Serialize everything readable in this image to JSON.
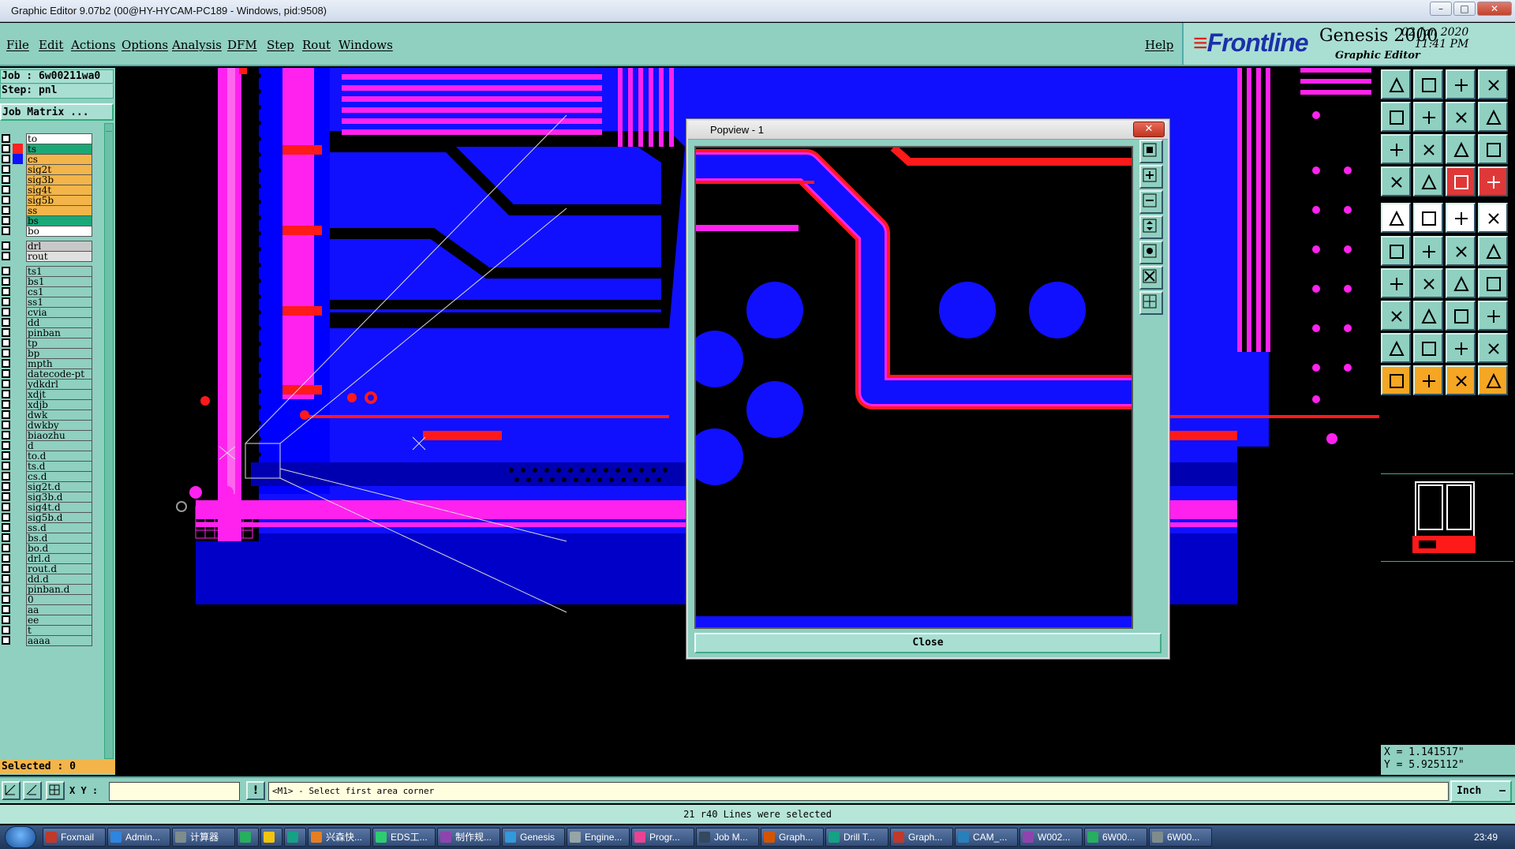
{
  "window": {
    "title": "Graphic Editor 9.07b2 (00@HY-HYCAM-PC189 - Windows, pid:9508)",
    "controls": [
      "–",
      "□",
      "✕"
    ]
  },
  "menu": {
    "items": [
      "File",
      "Edit",
      "Actions",
      "Options",
      "Analysis",
      "DFM",
      "Step",
      "Rout",
      "Windows"
    ],
    "help": "Help"
  },
  "brand": {
    "logo": "Frontline",
    "product": "Genesis 2000",
    "subtitle": "Graphic Editor",
    "date": "02 Jan 2020",
    "time": "11:41 PM"
  },
  "left_panel": {
    "job": "Job : 6w00211wa0",
    "step": "Step: pnl",
    "job_matrix": "Job Matrix ...",
    "selected": "Selected : 0"
  },
  "layers": [
    {
      "name": "to",
      "color": "#ffffff",
      "swatch": ""
    },
    {
      "name": "ts",
      "color": "#1aa877",
      "swatch": "#ff2020",
      "active": true
    },
    {
      "name": "cs",
      "color": "#f3b54a",
      "swatch": "#1010ff"
    },
    {
      "name": "sig2t",
      "color": "#f3b54a",
      "swatch": ""
    },
    {
      "name": "sig3b",
      "color": "#f3b54a",
      "swatch": ""
    },
    {
      "name": "sig4t",
      "color": "#f3b54a",
      "swatch": ""
    },
    {
      "name": "sig5b",
      "color": "#f3b54a",
      "swatch": ""
    },
    {
      "name": "ss",
      "color": "#f3b54a",
      "swatch": ""
    },
    {
      "name": "bs",
      "color": "#1aa877",
      "swatch": ""
    },
    {
      "name": "bo",
      "color": "#ffffff",
      "swatch": ""
    },
    {
      "name": "drl",
      "color": "#c8c8c8",
      "swatch": "",
      "gap": true
    },
    {
      "name": "rout",
      "color": "#e0e0e0",
      "swatch": ""
    },
    {
      "name": "ts1",
      "color": "#8fd0c0",
      "swatch": "",
      "gap": true
    },
    {
      "name": "bs1",
      "color": "#8fd0c0",
      "swatch": ""
    },
    {
      "name": "cs1",
      "color": "#8fd0c0",
      "swatch": ""
    },
    {
      "name": "ss1",
      "color": "#8fd0c0",
      "swatch": ""
    },
    {
      "name": "cvia",
      "color": "#8fd0c0",
      "swatch": ""
    },
    {
      "name": "dd",
      "color": "#8fd0c0",
      "swatch": ""
    },
    {
      "name": "pinban",
      "color": "#8fd0c0",
      "swatch": ""
    },
    {
      "name": "tp",
      "color": "#8fd0c0",
      "swatch": ""
    },
    {
      "name": "bp",
      "color": "#8fd0c0",
      "swatch": ""
    },
    {
      "name": "mpth",
      "color": "#8fd0c0",
      "swatch": ""
    },
    {
      "name": "datecode-pt",
      "color": "#8fd0c0",
      "swatch": ""
    },
    {
      "name": "ydkdrl",
      "color": "#8fd0c0",
      "swatch": ""
    },
    {
      "name": "xdjt",
      "color": "#8fd0c0",
      "swatch": ""
    },
    {
      "name": "xdjb",
      "color": "#8fd0c0",
      "swatch": ""
    },
    {
      "name": "dwk",
      "color": "#8fd0c0",
      "swatch": ""
    },
    {
      "name": "dwkby",
      "color": "#8fd0c0",
      "swatch": ""
    },
    {
      "name": "biaozhu",
      "color": "#8fd0c0",
      "swatch": ""
    },
    {
      "name": "d",
      "color": "#8fd0c0",
      "swatch": ""
    },
    {
      "name": "to.d",
      "color": "#8fd0c0",
      "swatch": ""
    },
    {
      "name": "ts.d",
      "color": "#8fd0c0",
      "swatch": ""
    },
    {
      "name": "cs.d",
      "color": "#8fd0c0",
      "swatch": ""
    },
    {
      "name": "sig2t.d",
      "color": "#8fd0c0",
      "swatch": ""
    },
    {
      "name": "sig3b.d",
      "color": "#8fd0c0",
      "swatch": ""
    },
    {
      "name": "sig4t.d",
      "color": "#8fd0c0",
      "swatch": ""
    },
    {
      "name": "sig5b.d",
      "color": "#8fd0c0",
      "swatch": ""
    },
    {
      "name": "ss.d",
      "color": "#8fd0c0",
      "swatch": ""
    },
    {
      "name": "bs.d",
      "color": "#8fd0c0",
      "swatch": ""
    },
    {
      "name": "bo.d",
      "color": "#8fd0c0",
      "swatch": ""
    },
    {
      "name": "drl.d",
      "color": "#8fd0c0",
      "swatch": ""
    },
    {
      "name": "rout.d",
      "color": "#8fd0c0",
      "swatch": ""
    },
    {
      "name": "dd.d",
      "color": "#8fd0c0",
      "swatch": ""
    },
    {
      "name": "pinban.d",
      "color": "#8fd0c0",
      "swatch": ""
    },
    {
      "name": "0",
      "color": "#8fd0c0",
      "swatch": ""
    },
    {
      "name": "aa",
      "color": "#8fd0c0",
      "swatch": ""
    },
    {
      "name": "ee",
      "color": "#8fd0c0",
      "swatch": ""
    },
    {
      "name": "t",
      "color": "#8fd0c0",
      "swatch": ""
    },
    {
      "name": "aaaa",
      "color": "#8fd0c0",
      "swatch": ""
    }
  ],
  "popview": {
    "title": "Popview - 1",
    "close_label": "Close"
  },
  "coords": {
    "x": "X = 1.141517\"",
    "y": "Y = 5.925112\""
  },
  "bottom": {
    "xy_label": "X Y :",
    "xy_value": "",
    "prompt": "<M1> - Select first area corner",
    "units": "Inch"
  },
  "status": "21 r40 Lines were selected",
  "taskbar": {
    "items": [
      "Foxmail",
      "Admin...",
      "计算器",
      "",
      "",
      "",
      "兴森快...",
      "EDS工...",
      "制作规...",
      "Genesis",
      "Engine...",
      "Progr...",
      "Job M...",
      "Graph...",
      "Drill T...",
      "Graph...",
      "CAM_...",
      "W002...",
      "6W00...",
      "6W00..."
    ],
    "clock": "23:49"
  },
  "colors": {
    "panel": "#8fd0c0",
    "accent_orange": "#f3b54a",
    "copper_blue": "#1010ff",
    "pad_magenta": "#ff00ff",
    "trace_red": "#ff1a1a"
  },
  "icons": [
    "toolbar-tool-icon"
  ]
}
